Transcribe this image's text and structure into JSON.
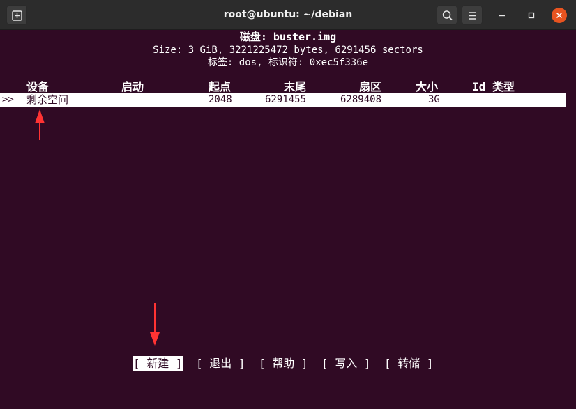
{
  "window": {
    "title": "root@ubuntu: ~/debian"
  },
  "titlebar": {
    "icons": [
      "new-tab-icon",
      "search-icon",
      "hamburger-menu-icon",
      "minimize-icon",
      "maximize-icon",
      "close-icon"
    ]
  },
  "disk": {
    "heading": "磁盘: buster.img",
    "size_line": "Size: 3 GiB, 3221225472 bytes, 6291456 sectors",
    "label_line": "标签: dos, 标识符: 0xec5f336e"
  },
  "table": {
    "columns": {
      "device": "设备",
      "boot": "启动",
      "start": "起点",
      "end": "末尾",
      "sectors": "扇区",
      "size": "大小",
      "id_type": "Id 类型"
    },
    "rows": [
      {
        "marker": ">>",
        "device": "剩余空间",
        "boot": "",
        "start": "2048",
        "end": "6291455",
        "sectors": "6289408",
        "size": "3G",
        "id_type": ""
      }
    ]
  },
  "menu": {
    "items": [
      "[ 新建 ]",
      "[ 退出 ]",
      "[ 帮助 ]",
      "[ 写入 ]",
      "[ 转储 ]"
    ],
    "selected_index": 0
  },
  "colors": {
    "terminal_bg": "#300a24",
    "titlebar_bg": "#2c2c2c",
    "close_button": "#e95420",
    "annotation_arrow": "#ff3333"
  }
}
